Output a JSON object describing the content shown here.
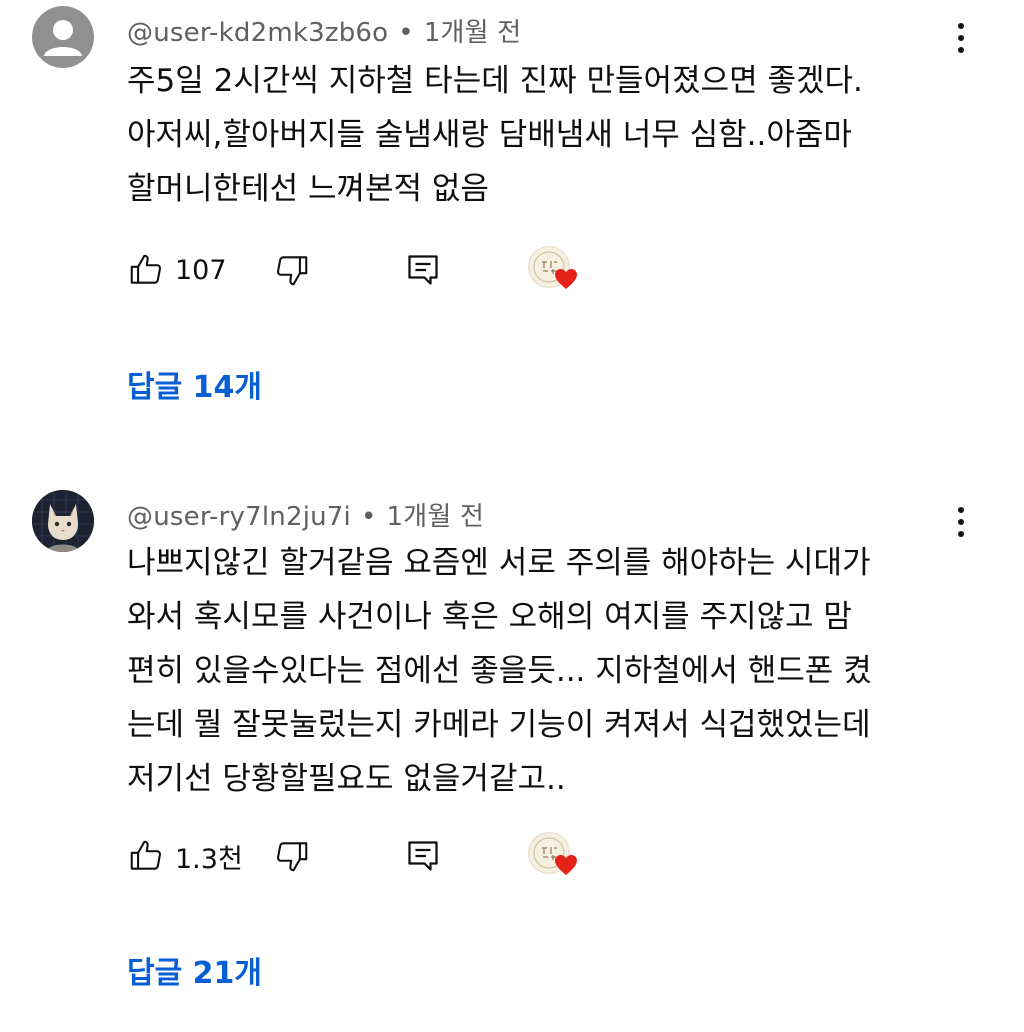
{
  "comments": [
    {
      "author": "@user-kd2mk3zb6o",
      "separator": "•",
      "time": "1개월 전",
      "lines": [
        "주5일 2시간씩 지하철 타는데 진짜 만들어졌으면 좋겠다.",
        "아저씨,할아버지들 술냄새랑 담배냄새 너무 심함..아줌마",
        "할머니한테선 느껴본적 없음"
      ],
      "likes": "107",
      "replies_label": "답글 14개",
      "avatar_icon": "default-user-icon"
    },
    {
      "author": "@user-ry7ln2ju7i",
      "separator": "•",
      "time": "1개월 전",
      "lines": [
        "나쁘지않긴 할거같음 요즘엔 서로 주의를 해야하는 시대가",
        "와서 혹시모를 사건이나 혹은 오해의 여지를 주지않고 맘",
        "편히 있을수있다는 점에선 좋을듯... 지하철에서 핸드폰 켰",
        "는데 뭘 잘못눌렀는지 카메라 기능이 켜져서 식겁했었는데",
        "저기선 당황할필요도 없을거같고.."
      ],
      "likes": "1.3천",
      "replies_label": "답글 21개",
      "avatar_icon": "cat-avatar-icon"
    }
  ],
  "colors": {
    "text": "#0f0f0f",
    "meta": "#606060",
    "link": "#065fd4",
    "heart": "#e62117",
    "default_avatar_bg": "#909090"
  },
  "icons": {
    "like": "thumbs-up-icon",
    "dislike": "thumbs-down-icon",
    "reply": "reply-comment-icon",
    "menu": "more-vertical-icon",
    "creator_heart": "creator-heart-icon"
  }
}
